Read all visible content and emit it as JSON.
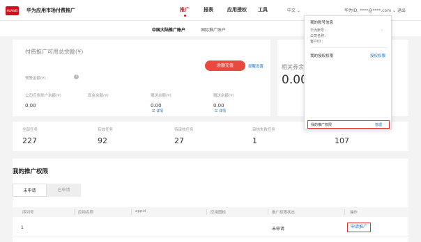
{
  "topnav": {
    "logo_text": "HUAWEI",
    "brand": "华为应用市场付费推广",
    "items": [
      "推广",
      "报表",
      "应用授权",
      "工具"
    ],
    "language": "中文",
    "user": "华为ID: ****@****.com",
    "exit": "退出"
  },
  "subtabs": [
    "中国大陆推广账户",
    "国际推广账户"
  ],
  "balance": {
    "title": "付费推广可用总余额(¥)",
    "recharge_button": "余额充值",
    "threshold_link": "提醒设置",
    "prewarn": "预警金额(¥) :",
    "help_icon": "?",
    "columns": [
      {
        "label": "公司应急账户余额(¥)",
        "value": "0.00",
        "link": ""
      },
      {
        "label": "现金余额(¥)",
        "value": "",
        "link": ""
      },
      {
        "label": "赠送余额(¥)",
        "value": "0.00",
        "link": "详情"
      },
      {
        "label": "赠送余额(¥)",
        "value": "0.00",
        "link": "详情"
      }
    ]
  },
  "coupon": {
    "label": "相关券余",
    "value": "0.00"
  },
  "stats": [
    {
      "label": "全部任务",
      "value": "227"
    },
    {
      "label": "有效任务",
      "value": "92"
    },
    {
      "label": "待审核任务",
      "value": "27"
    },
    {
      "label": "审核失败任务",
      "value": "1"
    },
    {
      "label": "",
      "value": "107"
    }
  ],
  "rights": {
    "title": "我的推广权限",
    "tabs": [
      "未申请",
      "已申请"
    ],
    "columns": [
      "序列号",
      "应用名称",
      "appid",
      "应用图标",
      "推广权限状态",
      "操作"
    ],
    "rows": [
      {
        "index": "1",
        "name": "",
        "appid": "",
        "icon": "",
        "status": "未申请",
        "action": "申请推广"
      }
    ]
  },
  "dropdown": {
    "header": "我的账号信息",
    "lines": [
      "华为账号 :",
      "公司名称 :",
      "客户ID :"
    ],
    "auth_label": "我的授权权限",
    "auth_link": "授权权限",
    "promo_label": "我的推广权限",
    "promo_link": "管理"
  },
  "colors": {
    "accent": "#d0101b",
    "link": "#1a73c8",
    "button": "#e84a3e",
    "highlight": "#e03030"
  }
}
